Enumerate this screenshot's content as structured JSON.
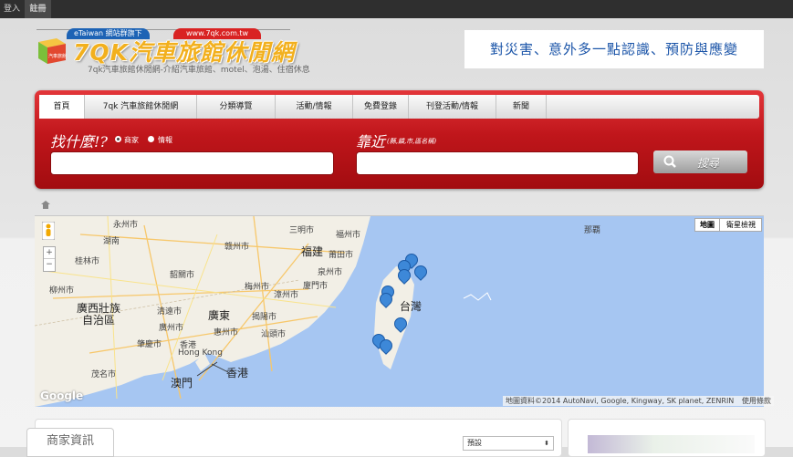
{
  "topbar": {
    "login": "登入",
    "register": "註冊"
  },
  "logo": {
    "title": "7QK汽車旅館休閒網",
    "tag_left": "eTaiwan 網站群旗下",
    "tag_right": "www.7qk.com.tw",
    "subtitle": "7qk汽車旅館休閒網-介紹汽車旅館、motel、泡湯、住宿休息",
    "box_text": "汽車旅館"
  },
  "banner": {
    "text": "對災害、意外多一點認識、預防與應變"
  },
  "nav": {
    "items": [
      "首頁",
      "7qk 汽車旅館休閒網",
      "分類導覽",
      "活動/情報",
      "免費登錄",
      "刊登活動/情報",
      "新聞"
    ]
  },
  "search": {
    "what_label": "找什麼!?",
    "radio_shop": "商家",
    "radio_info": "情報",
    "near_label": "靠近",
    "near_hint": "(縣,鎮,市,區名稱)",
    "button": "搜尋"
  },
  "map": {
    "type_map": "地圖",
    "type_sat": "衛星檢視",
    "zoom_in": "+",
    "zoom_out": "−",
    "attribution": "地圖資料©2014 AutoNavi, Google, Kingway, SK planet, ZENRIN",
    "terms": "使用條款",
    "google": "Google",
    "labels": {
      "yongzhou": "永州市",
      "hunan": "湖南",
      "ganzhou": "赣州市",
      "sanming": "三明市",
      "fuzhou": "福州市",
      "fujian": "福建",
      "putian": "莆田市",
      "quanzhou": "泉州市",
      "shaoguan": "韶關市",
      "guilin": "桂林市",
      "xiamen": "廈門市",
      "zhangzhou": "漳州市",
      "meizhou": "梅州市",
      "liuzhou": "柳州市",
      "guangxi": "廣西壯族",
      "zizhi": "自治區",
      "qingyuan": "清遠市",
      "guangdong": "廣東",
      "jieyang": "揭陽市",
      "shantou": "汕頭市",
      "guangzhou": "廣州市",
      "huizhou": "惠州市",
      "zhaoqing": "肇慶市",
      "hongkong_en": "Hong Kong",
      "xianggang": "香港",
      "xianggang2": "香港",
      "maoming": "茂名市",
      "macau": "澳門",
      "taiwan": "台灣",
      "naha": "那覇"
    }
  },
  "bottom": {
    "tab": "商家資訊",
    "sort": "預設"
  }
}
